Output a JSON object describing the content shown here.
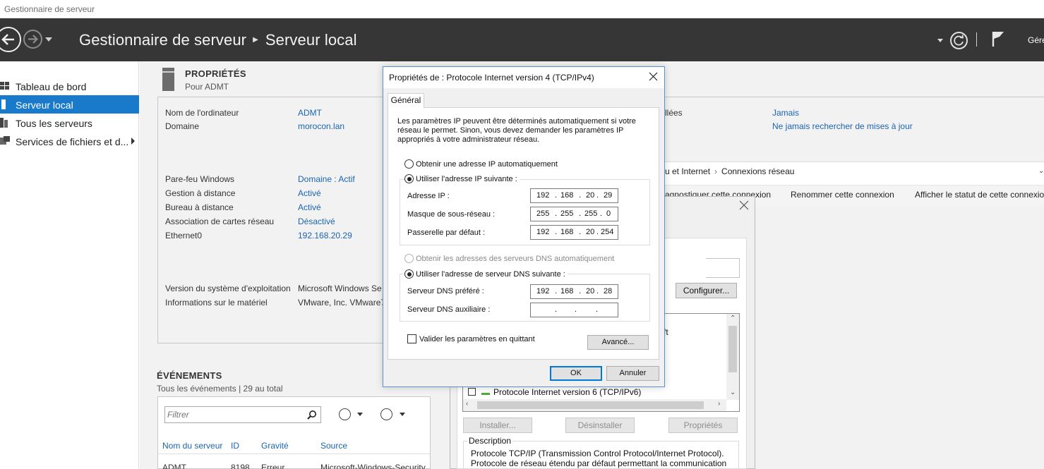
{
  "window": {
    "title": "Gestionnaire de serveur"
  },
  "header": {
    "app": "Gestionnaire de serveur",
    "page": "Serveur local",
    "manage_label": "Gére"
  },
  "sidebar": {
    "items": [
      {
        "label": "Tableau de bord"
      },
      {
        "label": "Serveur local"
      },
      {
        "label": "Tous les serveurs"
      },
      {
        "label": "Services de fichiers et d..."
      }
    ]
  },
  "properties": {
    "title": "PROPRIÉTÉS",
    "subtitle": "Pour ADMT",
    "rows_top": [
      {
        "key": "Nom de l'ordinateur",
        "value": "ADMT"
      },
      {
        "key": "Domaine",
        "value": "morocon.lan"
      }
    ],
    "rows_mid": [
      {
        "key": "Pare-feu Windows",
        "value": "Domaine : Actif"
      },
      {
        "key": "Gestion à distance",
        "value": "Activé"
      },
      {
        "key": "Bureau à distance",
        "value": "Activé"
      },
      {
        "key": "Association de cartes réseau",
        "value": "Désactivé"
      },
      {
        "key": "Ethernet0",
        "value": "192.168.20.29"
      }
    ],
    "rows_bottom": [
      {
        "key": "Version du système d'exploitation",
        "value": "Microsoft Windows Se"
      },
      {
        "key": "Informations sur le matériel",
        "value": "VMware, Inc. VMware7"
      }
    ],
    "right_rows": [
      {
        "key": "llées",
        "value": "Jamais"
      },
      {
        "key": "",
        "value": "Ne jamais rechercher de mises à jour"
      }
    ]
  },
  "events": {
    "title": "ÉVÉNEMENTS",
    "subtitle": "Tous les événements | 29 au total",
    "filter_placeholder": "Filtrer",
    "columns": [
      "Nom du serveur",
      "ID",
      "Gravité",
      "Source"
    ],
    "row": [
      "ADMT",
      "8198",
      "Erreur",
      "Microsoft-Windows-Security"
    ]
  },
  "network": {
    "breadcrumb": [
      "u et Internet",
      "Connexions réseau"
    ],
    "toolbar": [
      "agnostiquer cette connexion",
      "Renommer cette connexion",
      "Afficher le statut de cette connexion"
    ]
  },
  "ethernet_dialog": {
    "configure_label": "Configurer...",
    "partial_text": "ft",
    "list_item": "Protocole Internet version 6 (TCP/IPv6)",
    "buttons": [
      "Installer...",
      "Désinstaller",
      "Propriétés"
    ],
    "description_label": "Description",
    "description_text": "Protocole TCP/IP (Transmission Control Protocol/Internet Protocol). Protocole de réseau étendu par défaut permettant la communication entre différents"
  },
  "ipv4_dialog": {
    "title": "Propriétés de : Protocole Internet version 4 (TCP/IPv4)",
    "tab": "Général",
    "intro": "Les paramètres IP peuvent être déterminés automatiquement si votre réseau le permet. Sinon, vous devez demander les paramètres IP appropriés à votre administrateur réseau.",
    "radio_auto_ip": "Obtenir une adresse IP automatiquement",
    "radio_static_ip": "Utiliser l'adresse IP suivante :",
    "ip_label": "Adresse IP :",
    "ip": [
      "192",
      "168",
      "20",
      "29"
    ],
    "mask_label": "Masque de sous-réseau :",
    "mask": [
      "255",
      "255",
      "255",
      "0"
    ],
    "gateway_label": "Passerelle par défaut :",
    "gateway": [
      "192",
      "168",
      "20",
      "254"
    ],
    "radio_auto_dns": "Obtenir les adresses des serveurs DNS automatiquement",
    "radio_static_dns": "Utiliser l'adresse de serveur DNS suivante :",
    "dns1_label": "Serveur DNS préféré :",
    "dns1": [
      "192",
      "168",
      "20",
      "28"
    ],
    "dns2_label": "Serveur DNS auxiliaire :",
    "dns2": [
      "",
      "",
      "",
      ""
    ],
    "validate_label": "Valider les paramètres en quittant",
    "advanced_label": "Avancé...",
    "ok_label": "OK",
    "cancel_label": "Annuler"
  }
}
